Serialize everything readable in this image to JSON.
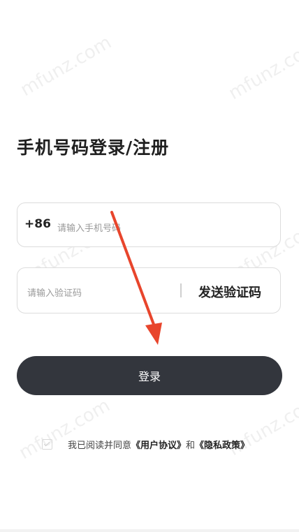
{
  "watermark": {
    "text": "mfunz.com"
  },
  "page": {
    "title": "手机号码登录/注册"
  },
  "phone": {
    "prefix": "+86",
    "placeholder": "请输入手机号码"
  },
  "code": {
    "placeholder": "请输入验证码",
    "send_label": "发送验证码"
  },
  "login": {
    "label": "登录"
  },
  "agreement": {
    "text_prefix": "我已阅读并同意",
    "user_agreement": "《用户协议》",
    "conjunction": "和",
    "privacy_policy": "《隐私政策》",
    "checked": false
  },
  "annotation": {
    "arrow_color": "#e8452c"
  },
  "colors": {
    "button_bg": "#33363d",
    "title": "#1f1f1f"
  }
}
